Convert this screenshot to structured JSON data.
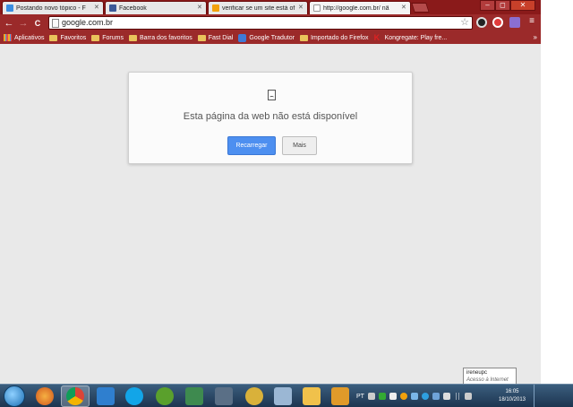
{
  "tabs": [
    {
      "label": "Postando novo tópico - F",
      "favicon_color": "#3a8de0"
    },
    {
      "label": "Facebook",
      "favicon_color": "#3b5998"
    },
    {
      "label": "verificar se um site está of",
      "favicon_color": "#f2a10c"
    },
    {
      "label": "http://google.com.br/ nã",
      "favicon_color": "#ffffff"
    }
  ],
  "window_controls": {
    "minimize": "–",
    "maximize": "◻",
    "close": "✕"
  },
  "toolbar": {
    "back": "←",
    "forward": "→",
    "reload": "C",
    "url": "google.com.br",
    "star": "☆"
  },
  "extensions": [
    {
      "icon": "extension-dark-icon",
      "color": "#222222"
    },
    {
      "icon": "extension-red-icon",
      "color": "#e23b3b"
    },
    {
      "icon": "extension-purple-icon",
      "color": "#8a6fd1"
    },
    {
      "icon": "menu-icon",
      "color": "#ffffff"
    }
  ],
  "bookmarks": [
    {
      "label": "Aplicativos",
      "icon": "apps-icon"
    },
    {
      "label": "Favoritos",
      "icon": "folder-icon"
    },
    {
      "label": "Forums",
      "icon": "folder-icon"
    },
    {
      "label": "Barra dos favoritos",
      "icon": "folder-icon"
    },
    {
      "label": "Fast Dial",
      "icon": "folder-icon"
    },
    {
      "label": "Google Tradutor",
      "icon": "translate-icon"
    },
    {
      "label": "Importado do Firefox",
      "icon": "folder-icon"
    },
    {
      "label": "Kongregate: Play fre...",
      "icon": "kongregate-icon"
    }
  ],
  "bookmarks_more": "»",
  "error": {
    "title": "Esta página da web não está disponível",
    "reload_button": "Recarregar",
    "more_button": "Mais"
  },
  "tooltip": {
    "user": "ireneupc",
    "status": "Acesso à Internet"
  },
  "taskbar": {
    "apps": [
      {
        "name": "firefox-icon",
        "color": "#e8772e"
      },
      {
        "name": "chrome-icon",
        "color": "#4caf50"
      },
      {
        "name": "maxthon-icon",
        "color": "#2f7fcf"
      },
      {
        "name": "skype-icon",
        "color": "#12a5e8"
      },
      {
        "name": "utorrent-icon",
        "color": "#5aa02c"
      },
      {
        "name": "spreadsheet-icon",
        "color": "#3e8a4f"
      },
      {
        "name": "burner-icon",
        "color": "#d9b13a"
      },
      {
        "name": "calculator-icon",
        "color": "#9bb7d4"
      },
      {
        "name": "explorer-icon",
        "color": "#f0c14b"
      },
      {
        "name": "media-player-icon",
        "color": "#e09a2a"
      }
    ],
    "language": "PT",
    "time": "16:05",
    "date": "18/10/2013"
  }
}
